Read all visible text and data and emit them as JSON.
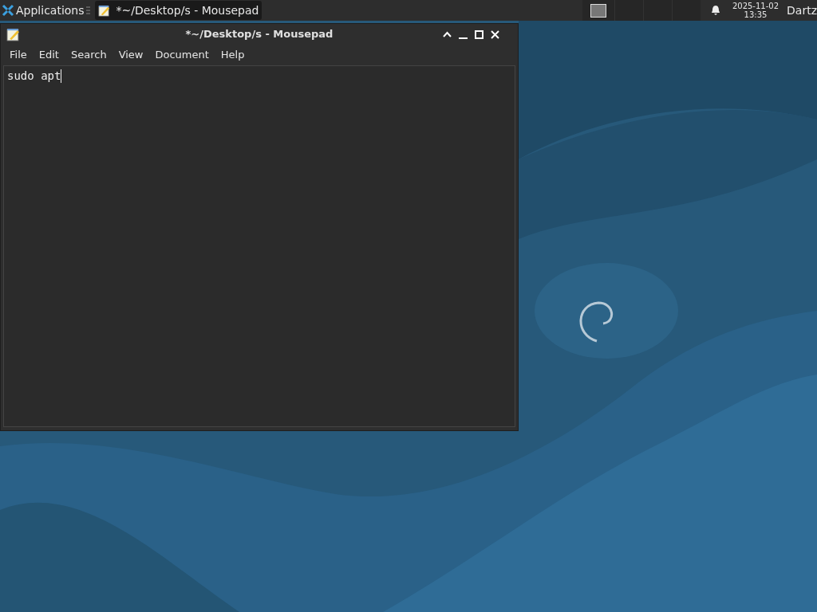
{
  "taskbar": {
    "applications": "Applications",
    "tasks": [
      {
        "title": "*~/Desktop/s - Mousepad",
        "selected": true
      }
    ],
    "clock": {
      "date": "2025-11-02",
      "time": "13:35"
    },
    "user": "Dartz"
  },
  "window": {
    "title": "*~/Desktop/s - Mousepad",
    "menu": [
      "File",
      "Edit",
      "Search",
      "View",
      "Document",
      "Help"
    ],
    "editor": {
      "text": "sudo apt"
    }
  }
}
